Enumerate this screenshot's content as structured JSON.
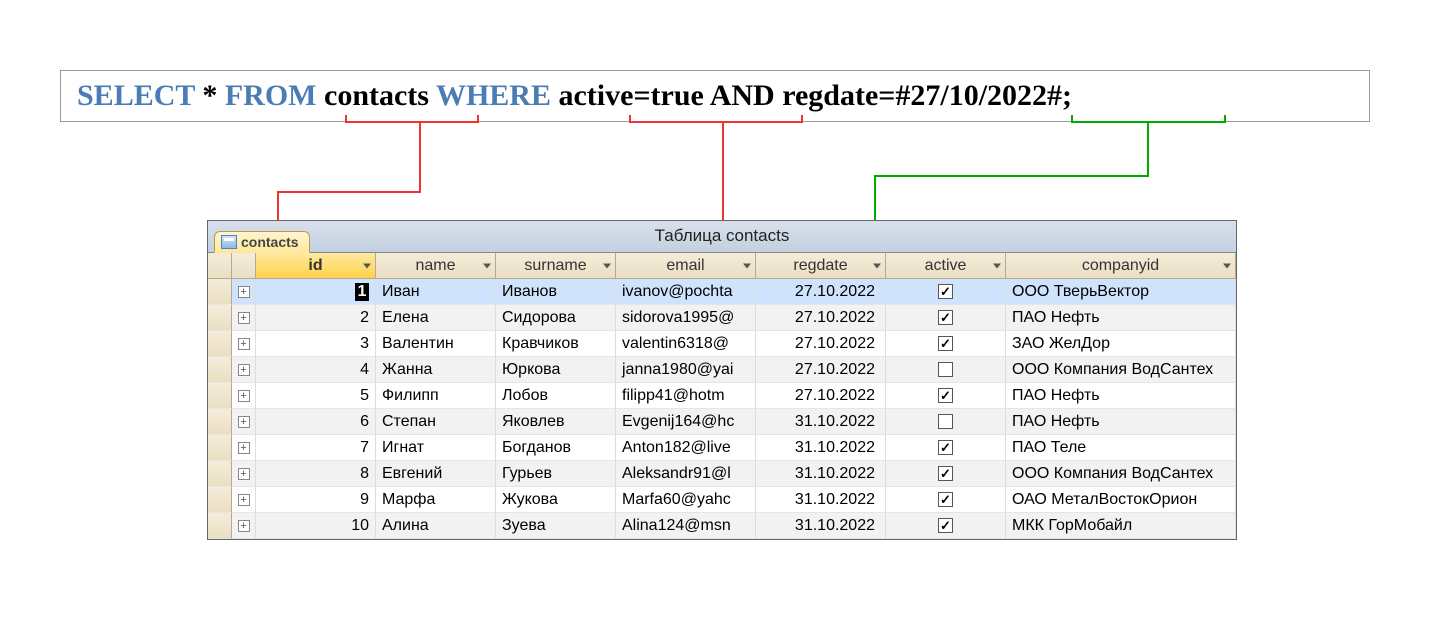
{
  "sql": {
    "select": "SELECT",
    "star": "*",
    "from": "FROM",
    "table": "contacts",
    "where": "WHERE",
    "cond1": "active=true",
    "and": "AND",
    "cond2": "regdate=#27/10/2022#;"
  },
  "tableWindow": {
    "tabLabel": "contacts",
    "title": "Таблица contacts"
  },
  "columns": [
    "id",
    "name",
    "surname",
    "email",
    "regdate",
    "active",
    "companyid"
  ],
  "rows": [
    {
      "id": "1",
      "name": "Иван",
      "surname": "Иванов",
      "email": "ivanov@pochta",
      "regdate": "27.10.2022",
      "active": true,
      "companyid": "ООО ТверьВектор"
    },
    {
      "id": "2",
      "name": "Елена",
      "surname": "Сидорова",
      "email": "sidorova1995@",
      "regdate": "27.10.2022",
      "active": true,
      "companyid": "ПАО Нефть"
    },
    {
      "id": "3",
      "name": "Валентин",
      "surname": "Кравчиков",
      "email": "valentin6318@",
      "regdate": "27.10.2022",
      "active": true,
      "companyid": "ЗАО ЖелДор"
    },
    {
      "id": "4",
      "name": "Жанна",
      "surname": "Юркова",
      "email": "janna1980@yai",
      "regdate": "27.10.2022",
      "active": false,
      "companyid": "ООО Компания ВодСантех"
    },
    {
      "id": "5",
      "name": "Филипп",
      "surname": "Лобов",
      "email": "filipp41@hotm",
      "regdate": "27.10.2022",
      "active": true,
      "companyid": "ПАО Нефть"
    },
    {
      "id": "6",
      "name": "Степан",
      "surname": "Яковлев",
      "email": "Evgenij164@hc",
      "regdate": "31.10.2022",
      "active": false,
      "companyid": "ПАО Нефть"
    },
    {
      "id": "7",
      "name": "Игнат",
      "surname": "Богданов",
      "email": "Anton182@live",
      "regdate": "31.10.2022",
      "active": true,
      "companyid": "ПАО Теле"
    },
    {
      "id": "8",
      "name": "Евгений",
      "surname": "Гурьев",
      "email": "Aleksandr91@l",
      "regdate": "31.10.2022",
      "active": true,
      "companyid": "ООО Компания ВодСантех"
    },
    {
      "id": "9",
      "name": "Марфа",
      "surname": "Жукова",
      "email": "Marfa60@yahc",
      "regdate": "31.10.2022",
      "active": true,
      "companyid": "ОАО МеталВостокОрион"
    },
    {
      "id": "10",
      "name": "Алина",
      "surname": "Зуева",
      "email": "Alina124@msn",
      "regdate": "31.10.2022",
      "active": true,
      "companyid": "МКК ГорМобайл"
    }
  ]
}
